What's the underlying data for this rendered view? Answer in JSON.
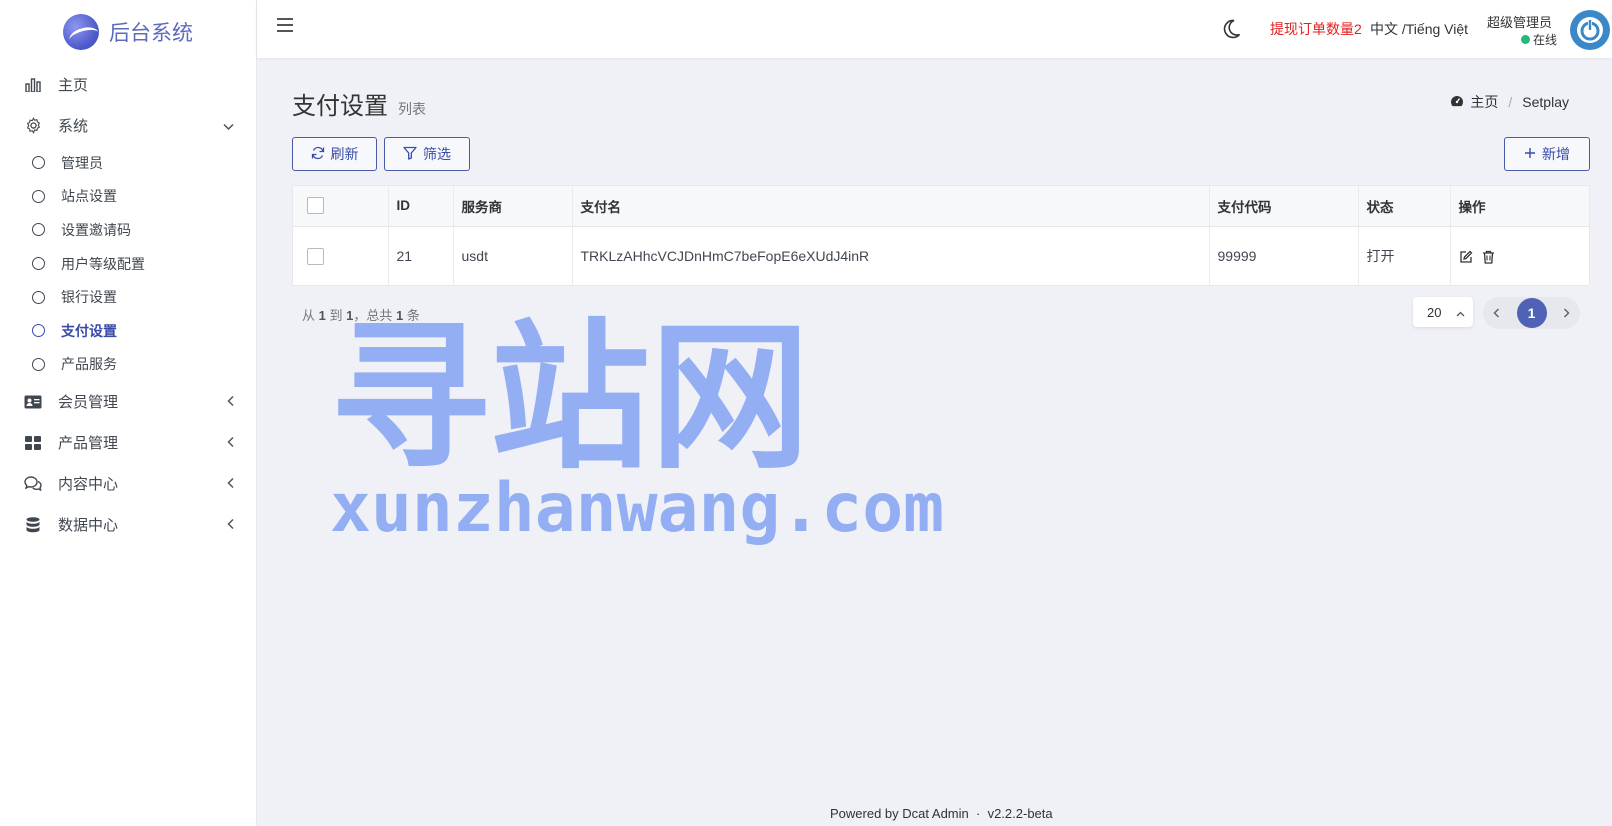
{
  "brand": {
    "name": "后台系统"
  },
  "sidebar": {
    "home": "主页",
    "system": "系统",
    "system_items": [
      "管理员",
      "站点设置",
      "设置邀请码",
      "用户等级配置",
      "银行设置",
      "支付设置",
      "产品服务"
    ],
    "member": "会员管理",
    "product": "产品管理",
    "content": "内容中心",
    "data": "数据中心"
  },
  "topbar": {
    "withdraw_orders": "提现订单数量2",
    "language": "中文 /Tiếng Việt",
    "user_name": "超级管理员",
    "user_status": "在线"
  },
  "page": {
    "title": "支付设置",
    "description": "列表",
    "breadcrumb_home": "主页",
    "breadcrumb_current": "Setplay"
  },
  "toolbar": {
    "refresh": "刷新",
    "filter": "筛选",
    "new": "新增"
  },
  "table": {
    "headers": [
      "ID",
      "服务商",
      "支付名",
      "支付代码",
      "状态",
      "操作"
    ],
    "rows": [
      {
        "id": "21",
        "provider": "usdt",
        "name": "TRKLzAHhcVCJDnHmC7beFopE6eXUdJ4inR",
        "code": "99999",
        "status": "打开"
      }
    ]
  },
  "summary": {
    "prefix": "从",
    "from": "1",
    "to_word": "到",
    "to": "1",
    "total_word": "，总共",
    "total": "1",
    "unit": "条"
  },
  "pagination": {
    "per_page": "20",
    "current": "1"
  },
  "watermark": {
    "cn": "寻站网",
    "en": "xunzhanwang.com"
  },
  "footer": {
    "powered": "Powered by",
    "product": "Dcat Admin",
    "sep": "·",
    "version": "v2.2.2-beta"
  },
  "colors": {
    "accent": "#3a4ba8",
    "alert": "#e32020",
    "online": "#21b978"
  }
}
